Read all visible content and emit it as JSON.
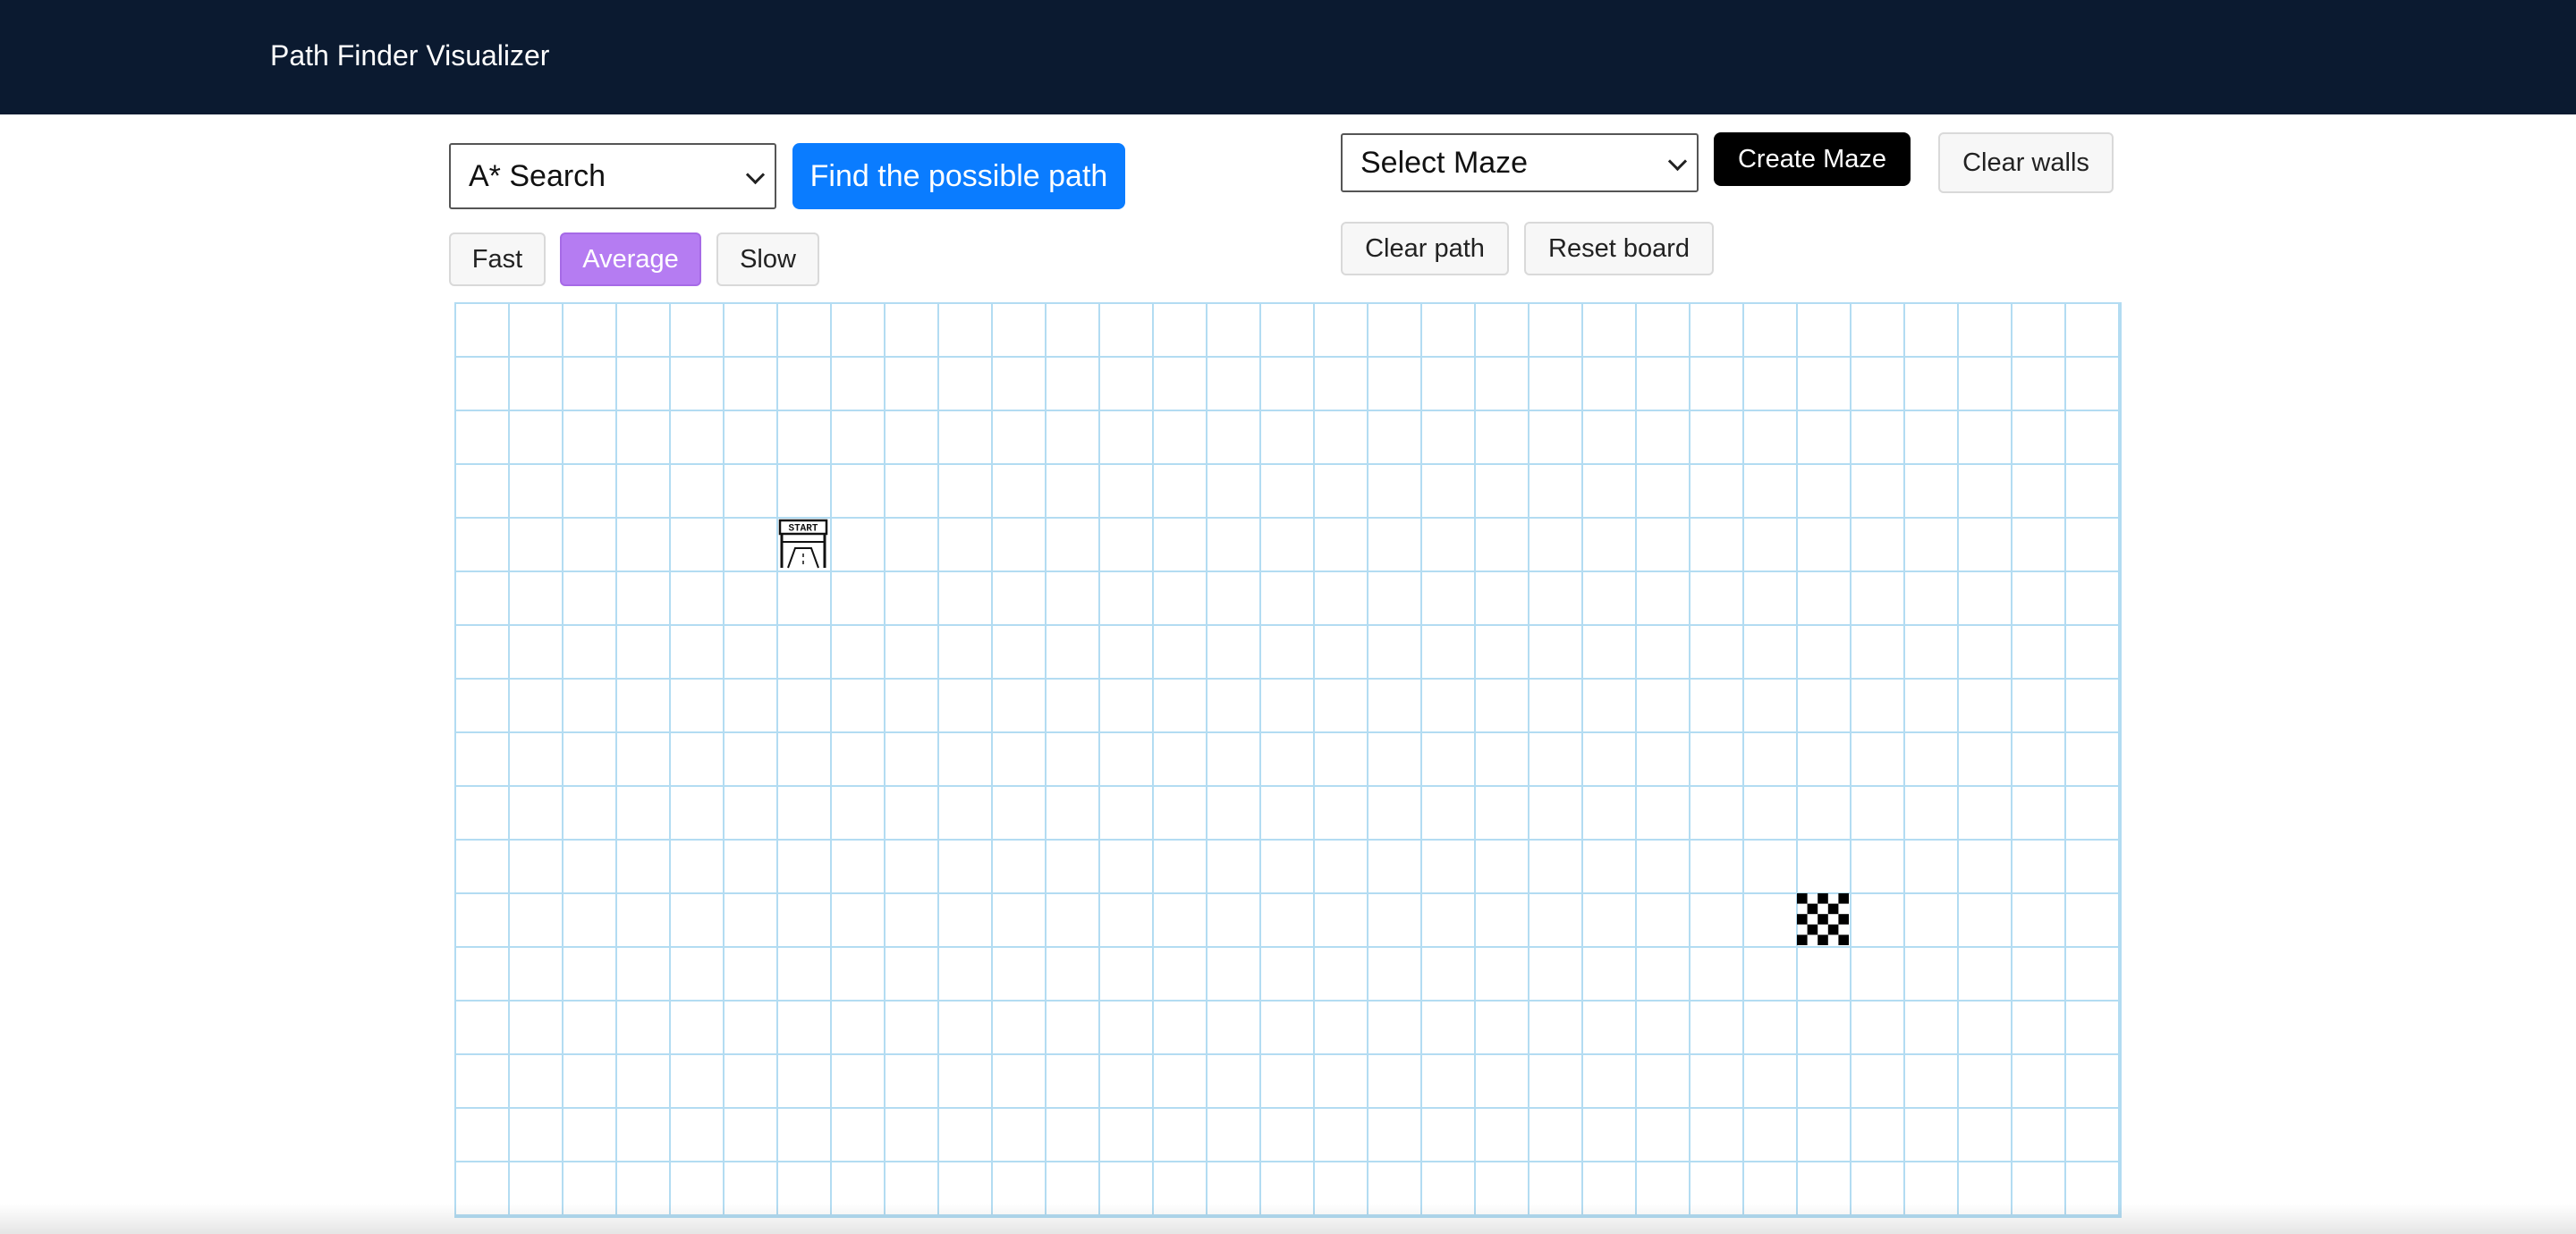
{
  "navbar": {
    "brand": "Path Finder Visualizer"
  },
  "controls": {
    "algorithm_select": {
      "selected": "A* Search"
    },
    "find_path_label": "Find the possible path",
    "speed": {
      "options": [
        "Fast",
        "Average",
        "Slow"
      ],
      "active": "Average"
    },
    "maze_select": {
      "selected": "Select Maze"
    },
    "create_maze_label": "Create Maze",
    "clear_walls_label": "Clear walls",
    "clear_path_label": "Clear path",
    "reset_board_label": "Reset board"
  },
  "board": {
    "columns": 31,
    "rows": 17,
    "start_node": {
      "row": 4,
      "col": 6,
      "label": "START"
    },
    "target_node": {
      "row": 11,
      "col": 25
    },
    "colors": {
      "grid_line": "#b3dcf2",
      "navbar": "#0b1a30",
      "primary": "#0a7cff",
      "speed_active": "#b57cf2"
    }
  }
}
